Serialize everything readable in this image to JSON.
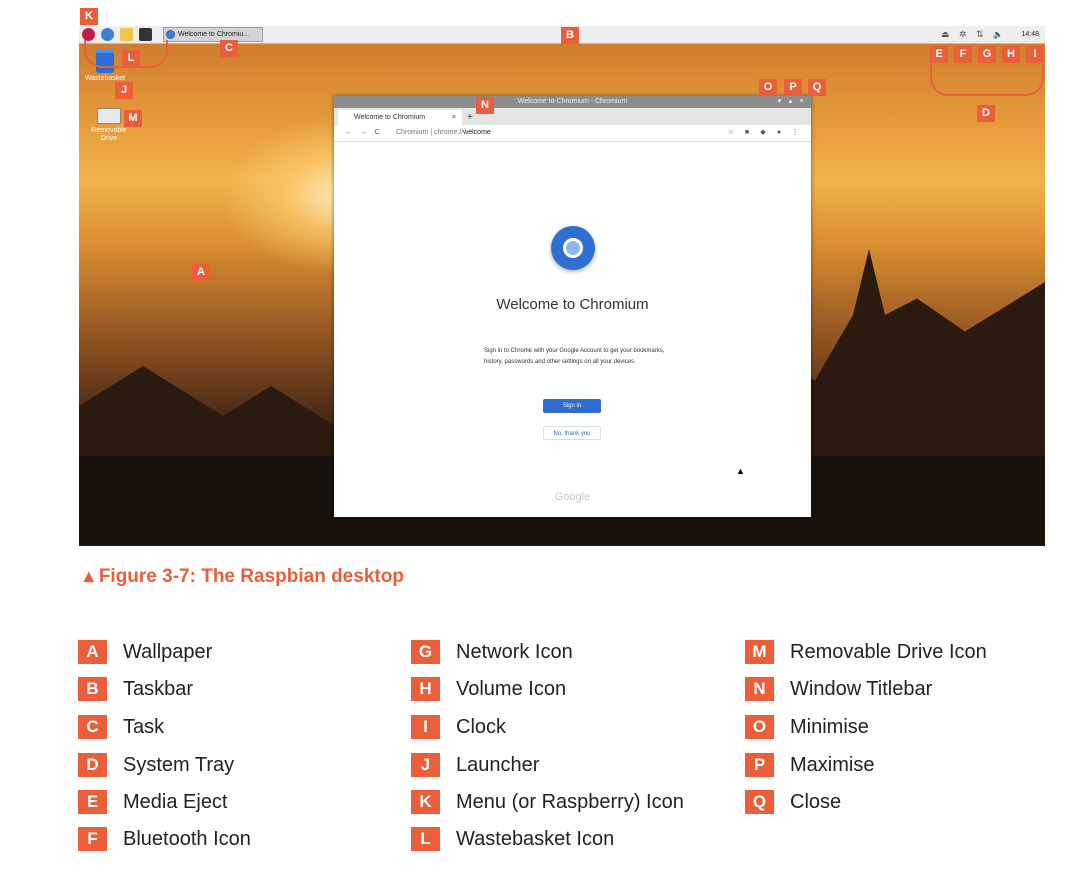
{
  "taskbar": {
    "task_label": "Welcome to Chromiu...",
    "clock": "14:48"
  },
  "desktop": {
    "wastebasket_label": "Wastebasket",
    "removable_label": "Removable Drive"
  },
  "window": {
    "title": "Welcome to Chromium - Chromium",
    "minimise": "▾",
    "maximise": "▴",
    "close": "×",
    "tab_label": "Welcome to Chromium",
    "tab_close": "×",
    "new_tab": "+",
    "back": "←",
    "forward": "→",
    "reload": "C",
    "url_host": "Chromium | chrome://",
    "url_path": "welcome",
    "heading": "Welcome to Chromium",
    "body": "Sign in to Chrome with your Google Account to get your bookmarks, history, passwords and other settings on all your devices.",
    "sign_in": "Sign in",
    "no_thanks": "No, thank you",
    "footer": "Google"
  },
  "tray": {
    "eject": "⏏",
    "bluetooth": "✲",
    "network": "⇅",
    "volume": "🔈"
  },
  "callouts": {
    "A": "A",
    "B": "B",
    "C": "C",
    "D": "D",
    "E": "E",
    "F": "F",
    "G": "G",
    "H": "H",
    "I": "I",
    "J": "J",
    "K": "K",
    "L": "L",
    "M": "M",
    "N": "N",
    "O": "O",
    "P": "P",
    "Q": "Q"
  },
  "caption": "▴ Figure 3-7: The Raspbian desktop",
  "legend": [
    {
      "key": "A",
      "label": "Wallpaper"
    },
    {
      "key": "B",
      "label": "Taskbar"
    },
    {
      "key": "C",
      "label": "Task"
    },
    {
      "key": "D",
      "label": "System Tray"
    },
    {
      "key": "E",
      "label": "Media Eject"
    },
    {
      "key": "F",
      "label": "Bluetooth Icon"
    },
    {
      "key": "G",
      "label": "Network Icon"
    },
    {
      "key": "H",
      "label": "Volume Icon"
    },
    {
      "key": "I",
      "label": "Clock"
    },
    {
      "key": "J",
      "label": "Launcher"
    },
    {
      "key": "K",
      "label": "Menu (or Raspberry) Icon"
    },
    {
      "key": "L",
      "label": "Wastebasket Icon"
    },
    {
      "key": "M",
      "label": "Removable Drive Icon"
    },
    {
      "key": "N",
      "label": "Window Titlebar"
    },
    {
      "key": "O",
      "label": "Minimise"
    },
    {
      "key": "P",
      "label": "Maximise"
    },
    {
      "key": "Q",
      "label": "Close"
    }
  ]
}
